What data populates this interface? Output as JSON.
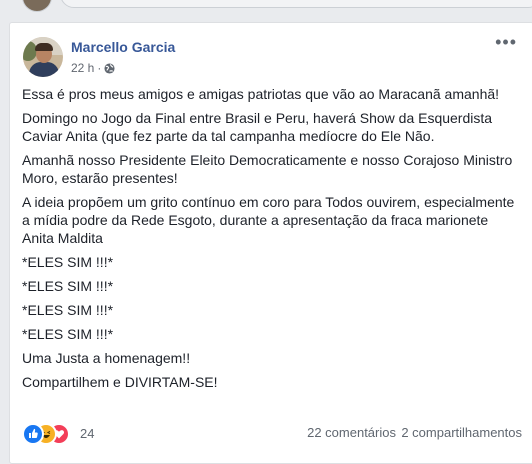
{
  "post": {
    "author": "Marcello Garcia",
    "time": "22 h",
    "time_separator": "·",
    "audience_icon": "globe-icon",
    "more_label": "•••",
    "paragraphs": [
      "Essa é pros meus amigos e amigas patriotas que vão ao Maracanã amanhã!",
      "Domingo no Jogo da Final entre Brasil e Peru, haverá Show da Esquerdista Caviar Anita (que fez parte da tal campanha medíocre do Ele Não.",
      "Amanhã nosso Presidente Eleito Democraticamente e nosso Corajoso Ministro Moro, estarão presentes!",
      "A ideia propõem um grito contínuo em coro para Todos ouvirem, especialmente a mídia podre da Rede Esgoto, durante a apresentação da fraca marionete Anita Maldita",
      "*ELES SIM !!!*",
      "*ELES SIM !!!*",
      "*ELES SIM !!!*",
      "*ELES SIM !!!*",
      "Uma Justa a homenagem!!",
      "Compartilhem e DIVIRTAM-SE!"
    ],
    "reactions": {
      "icons": [
        "like-icon",
        "haha-icon",
        "love-icon"
      ],
      "count": "24"
    },
    "comments": "22 comentários",
    "shares": "2 compartilhamentos"
  },
  "colors": {
    "author": "#385898",
    "like": "#1877f2",
    "haha": "#f7b125",
    "love": "#f33e58"
  }
}
